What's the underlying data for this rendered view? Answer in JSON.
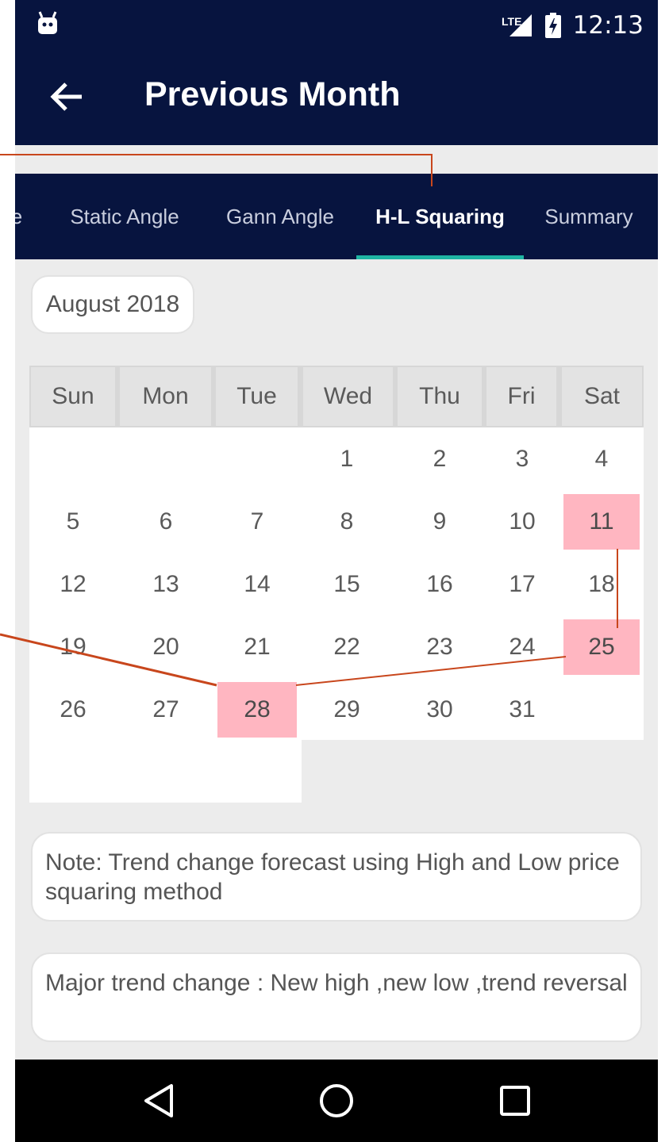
{
  "status_bar": {
    "network_label": "LTE",
    "time": "12:13",
    "app_icon": "android-notification-icon",
    "signal_icon": "cell-signal-icon",
    "battery_icon": "battery-charging-icon"
  },
  "app_bar": {
    "title": "Previous Month",
    "back_icon": "arrow-left-icon"
  },
  "tabs": [
    {
      "label": "e",
      "active": false
    },
    {
      "label": "Static Angle",
      "active": false
    },
    {
      "label": "Gann Angle",
      "active": false
    },
    {
      "label": "H-L Squaring",
      "active": true
    },
    {
      "label": "Summary",
      "active": false
    }
  ],
  "month_selector": {
    "label": "August 2018"
  },
  "calendar": {
    "weekdays": [
      "Sun",
      "Mon",
      "Tue",
      "Wed",
      "Thu",
      "Fri",
      "Sat"
    ],
    "weeks": [
      [
        "",
        "",
        "",
        "1",
        "2",
        "3",
        "4"
      ],
      [
        "5",
        "6",
        "7",
        "8",
        "9",
        "10",
        "11"
      ],
      [
        "12",
        "13",
        "14",
        "15",
        "16",
        "17",
        "18"
      ],
      [
        "19",
        "20",
        "21",
        "22",
        "23",
        "24",
        "25"
      ],
      [
        "26",
        "27",
        "28",
        "29",
        "30",
        "31",
        ""
      ]
    ],
    "highlighted_days": [
      "11",
      "25",
      "28"
    ],
    "highlight_color": "#ffb6c1"
  },
  "notes": [
    "Note: Trend change forecast using High and Low price squaring method",
    "Major trend change : New high ,new low ,trend reversal"
  ],
  "nav_bar": {
    "back": "triangle-back-icon",
    "home": "circle-home-icon",
    "recents": "square-recents-icon"
  },
  "colors": {
    "header": "#07143f",
    "tab_indicator": "#1fb5a3",
    "annotation_line": "#c8461c"
  }
}
